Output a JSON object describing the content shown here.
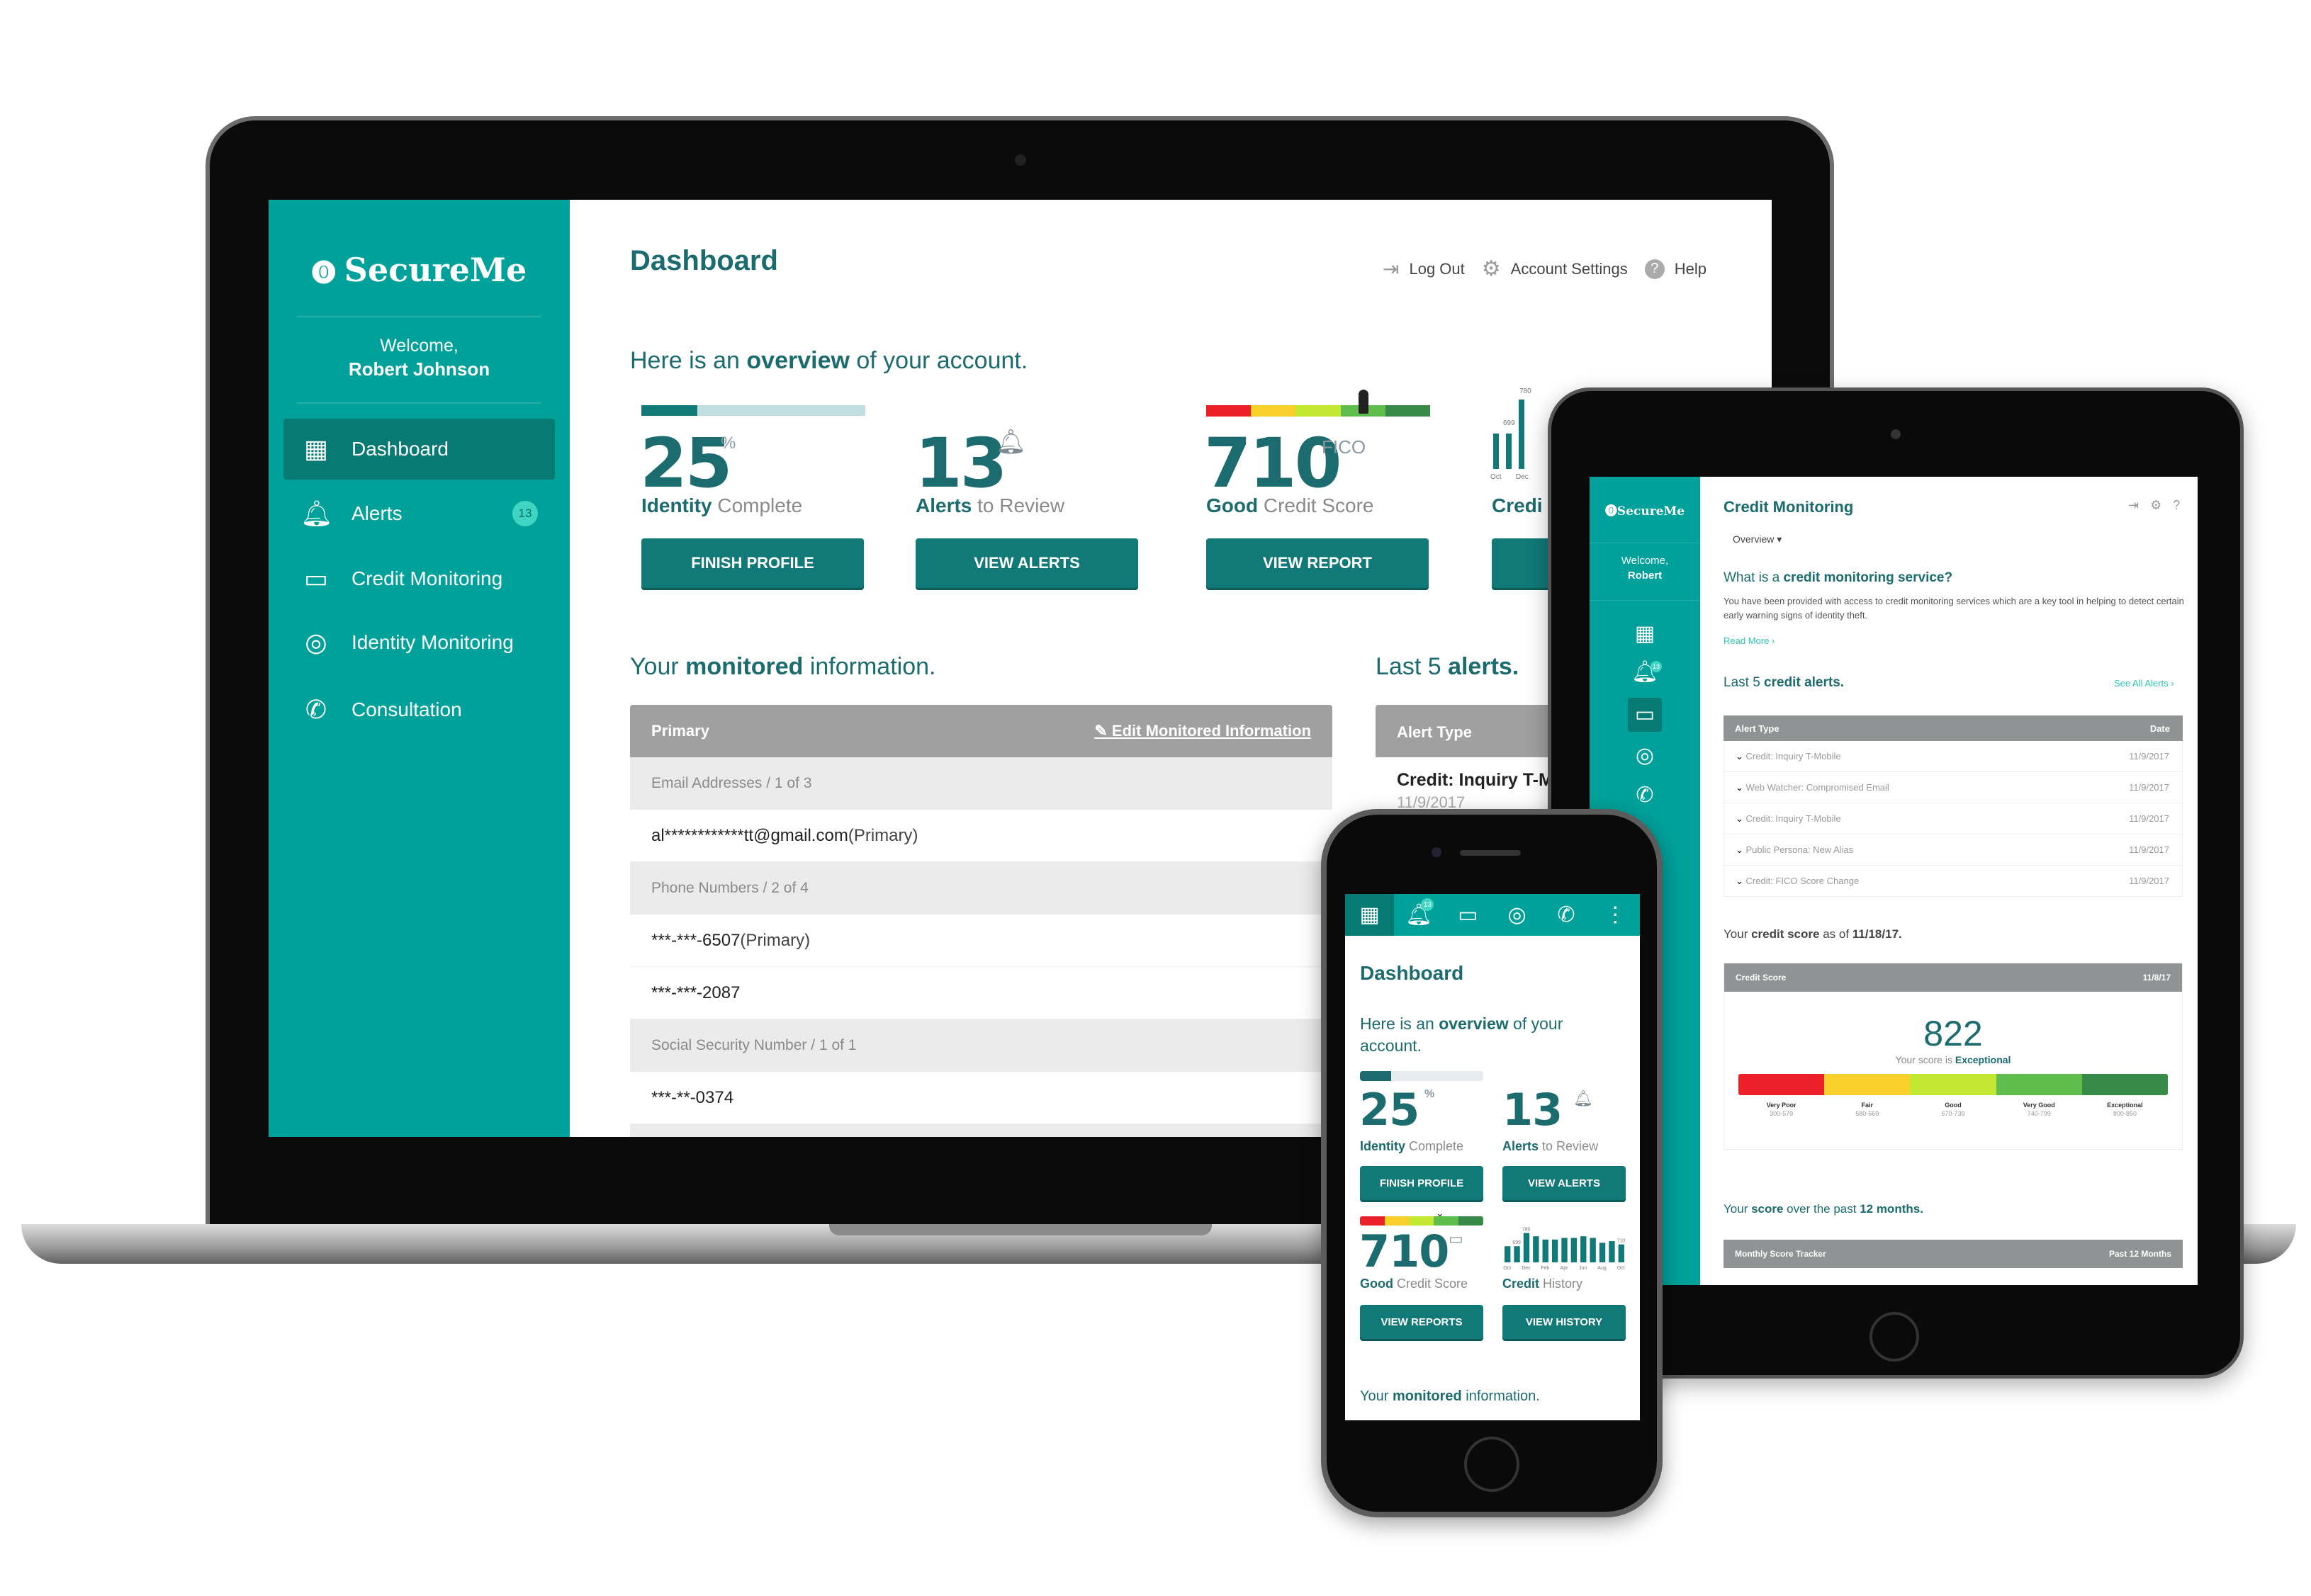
{
  "brand": {
    "name": "SecureMe",
    "teal": "#00a19a",
    "dark_teal": "#1b6b6f",
    "button": "#117a78",
    "badge": "#3ed6c3"
  },
  "laptop": {
    "sidebar": {
      "welcome": "Welcome,",
      "user": "Robert Johnson",
      "items": [
        {
          "label": "Dashboard",
          "icon": "dashboard-icon",
          "active": true
        },
        {
          "label": "Alerts",
          "icon": "bell-icon",
          "badge": "13"
        },
        {
          "label": "Credit Monitoring",
          "icon": "credit-card-icon"
        },
        {
          "label": "Identity Monitoring",
          "icon": "fingerprint-icon"
        },
        {
          "label": "Consultation",
          "icon": "phone-icon"
        }
      ]
    },
    "header": {
      "title": "Dashboard",
      "logout": "Log Out",
      "settings": "Account Settings",
      "help": "Help"
    },
    "overview": {
      "pre": "Here is an ",
      "bold": "overview",
      "post": " of your account."
    },
    "cards": [
      {
        "value": "25",
        "sup": "%",
        "label_bold": "Identity",
        "label": " Complete",
        "button": "FINISH PROFILE",
        "progress": 0.25
      },
      {
        "value": "13",
        "label_bold": "Alerts",
        "label": " to Review",
        "button": "VIEW ALERTS"
      },
      {
        "value": "710",
        "sup": "FICO",
        "label_bold": "Good",
        "label": " Credit Score",
        "button": "VIEW REPORT"
      },
      {
        "label_bold": "Credi",
        "chart_labels": [
          "780",
          "699",
          "Oct",
          "Dec"
        ]
      }
    ],
    "monitored": {
      "pre": "Your ",
      "bold": "monitored",
      "post": " information.",
      "header": "Primary",
      "edit": "Edit Monitored Information",
      "rows": [
        {
          "type": "group",
          "label": "Email Addresses",
          "count": "1 of 3"
        },
        {
          "type": "value",
          "text": "al************tt@gmail.com",
          "note": " (Primary)"
        },
        {
          "type": "group",
          "label": "Phone Numbers",
          "count": "2 of 4"
        },
        {
          "type": "value",
          "text": "***-***-6507",
          "note": " (Primary)"
        },
        {
          "type": "value",
          "text": "***-***-2087",
          "note": ""
        },
        {
          "type": "group",
          "label": "Social Security Number",
          "count": "1 of 1"
        },
        {
          "type": "value",
          "text": "***-**-0374",
          "note": ""
        }
      ]
    },
    "alerts": {
      "pre": "Last 5 ",
      "bold": "alerts.",
      "header": "Alert Type",
      "first": "Credit: Inquiry T-M",
      "first_date": "11/9/2017"
    }
  },
  "tablet": {
    "sidebar": {
      "welcome": "Welcome,",
      "user": "Robert",
      "badge": "13"
    },
    "title": "Credit Monitoring",
    "dropdown": "Overview",
    "what": {
      "pre": "What is a ",
      "bold": "credit monitoring service?"
    },
    "desc": "You have been provided with access to credit monitoring services which are a key tool in helping to detect certain early warning signs of identity theft.",
    "read_more": "Read More ›",
    "alerts_title": {
      "pre": "Last 5 ",
      "bold": "credit alerts."
    },
    "see_all": "See All Alerts ›",
    "alerts_header": {
      "type": "Alert Type",
      "date": "Date"
    },
    "alerts": [
      {
        "type": "Credit: Inquiry T-Mobile",
        "date": "11/9/2017"
      },
      {
        "type": "Web Watcher: Compromised Email",
        "date": "11/9/2017"
      },
      {
        "type": "Credit: Inquiry T-Mobile",
        "date": "11/9/2017"
      },
      {
        "type": "Public Persona: New Alias",
        "date": "11/9/2017"
      },
      {
        "type": "Credit: FICO Score Change",
        "date": "11/9/2017"
      }
    ],
    "score_title": {
      "pre": "Your ",
      "bold": "credit score",
      "mid": " as of ",
      "date": "11/18/17."
    },
    "score_card": {
      "header": "Credit Score",
      "date": "11/8/17",
      "score": "822",
      "caption": "Your score is ",
      "rating": "Exceptional",
      "bands": [
        {
          "name": "Very Poor",
          "range": "300-579",
          "color": "#ec2028"
        },
        {
          "name": "Fair",
          "range": "580-669",
          "color": "#f9d02a"
        },
        {
          "name": "Good",
          "range": "670-739",
          "color": "#c3e831"
        },
        {
          "name": "Very Good",
          "range": "740-799",
          "color": "#5fbd4e"
        },
        {
          "name": "Exceptional",
          "range": "800-850",
          "color": "#388a48"
        }
      ]
    },
    "history_title": {
      "pre": "Your ",
      "bold": "score",
      "mid": " over the past ",
      "months": "12 months."
    },
    "tracker": {
      "header": "Monthly Score Tracker",
      "range": "Past 12 Months"
    }
  },
  "phone": {
    "nav_badge": "13",
    "title": "Dashboard",
    "overview": {
      "pre": "Here is an ",
      "bold": "overview",
      "post": " of your account."
    },
    "cards": [
      {
        "value": "25",
        "sup": "%",
        "label_bold": "Identity",
        "label": " Complete",
        "button": "FINISH PROFILE",
        "progress": 0.25
      },
      {
        "value": "13",
        "label_bold": "Alerts",
        "label": " to Review",
        "button": "VIEW ALERTS"
      },
      {
        "value": "710",
        "label_bold": "Good",
        "label": " Credit Score",
        "button": "VIEW REPORTS"
      },
      {
        "label_bold": "Credit",
        "label": " History",
        "button": "VIEW HISTORY"
      }
    ],
    "credit_history": {
      "values": [
        699,
        699,
        780,
        760,
        740,
        740,
        750,
        750,
        760,
        750,
        720,
        730,
        710
      ],
      "value_labels": [
        "699",
        "780",
        "710"
      ],
      "month_labels": [
        "Oct",
        "Dec",
        "Feb",
        "Apr",
        "Jun",
        "Aug",
        "Oct"
      ]
    },
    "monitored": {
      "pre": "Your ",
      "bold": "monitored",
      "post": " information."
    }
  }
}
